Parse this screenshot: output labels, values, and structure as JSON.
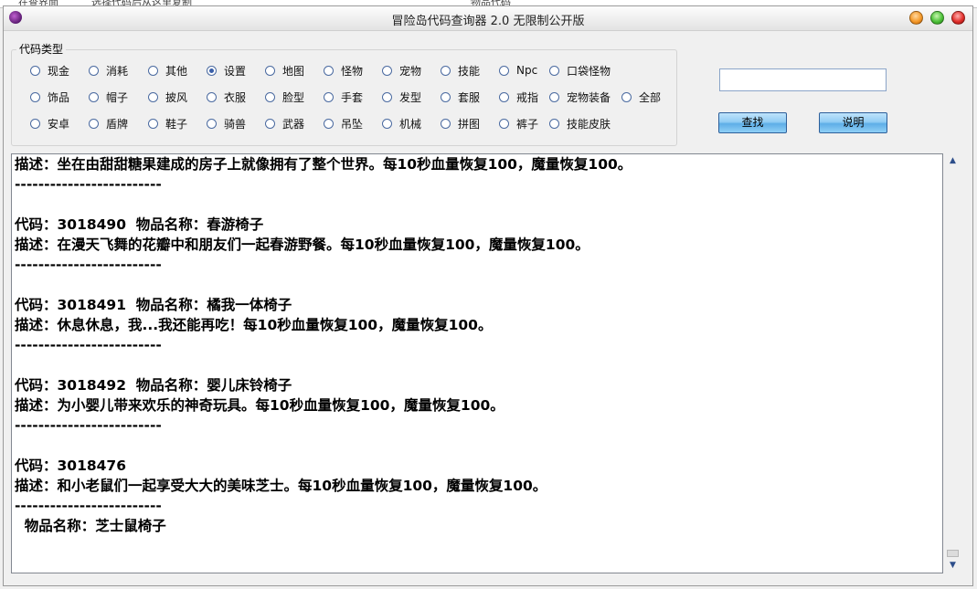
{
  "background_window": {
    "left_text": "在查界面",
    "mid_text": "选择代码后从这里复制",
    "right_text": "物品代码"
  },
  "window": {
    "title": "冒险岛代码查询器 2.0 无限制公开版",
    "controls": {
      "minimize": "minimize",
      "maximize": "maximize",
      "close": "close"
    }
  },
  "code_type": {
    "label": "代码类型",
    "selected": "设置",
    "options": [
      {
        "label": "现金",
        "checked": false
      },
      {
        "label": "消耗",
        "checked": false
      },
      {
        "label": "其他",
        "checked": false
      },
      {
        "label": "设置",
        "checked": true
      },
      {
        "label": "地图",
        "checked": false
      },
      {
        "label": "怪物",
        "checked": false
      },
      {
        "label": "宠物",
        "checked": false
      },
      {
        "label": "技能",
        "checked": false
      },
      {
        "label": "Npc",
        "checked": false
      },
      {
        "label": "口袋怪物",
        "checked": false
      },
      {
        "label": "饰品",
        "checked": false
      },
      {
        "label": "帽子",
        "checked": false
      },
      {
        "label": "披风",
        "checked": false
      },
      {
        "label": "衣服",
        "checked": false
      },
      {
        "label": "脸型",
        "checked": false
      },
      {
        "label": "手套",
        "checked": false
      },
      {
        "label": "发型",
        "checked": false
      },
      {
        "label": "套服",
        "checked": false
      },
      {
        "label": "戒指",
        "checked": false
      },
      {
        "label": "宠物装备",
        "checked": false
      },
      {
        "label": "全部",
        "checked": false
      },
      {
        "label": "安卓",
        "checked": false
      },
      {
        "label": "盾牌",
        "checked": false
      },
      {
        "label": "鞋子",
        "checked": false
      },
      {
        "label": "骑兽",
        "checked": false
      },
      {
        "label": "武器",
        "checked": false
      },
      {
        "label": "吊坠",
        "checked": false
      },
      {
        "label": "机械",
        "checked": false
      },
      {
        "label": "拼图",
        "checked": false
      },
      {
        "label": "裤子",
        "checked": false
      },
      {
        "label": "技能皮肤",
        "checked": false
      }
    ]
  },
  "search": {
    "value": "",
    "placeholder": ""
  },
  "buttons": {
    "find": "查找",
    "help": "说明"
  },
  "results": {
    "lines": [
      "描述：坐在由甜甜糖果建成的房子上就像拥有了整个世界。每10秒血量恢复100，魔量恢复100。",
      "-------------------------",
      "",
      "代码：3018490  物品名称：春游椅子",
      "描述：在漫天飞舞的花瓣中和朋友们一起春游野餐。每10秒血量恢复100，魔量恢复100。",
      "-------------------------",
      "",
      "代码：3018491  物品名称：橘我一体椅子",
      "描述：休息休息，我...我还能再吃！每10秒血量恢复100，魔量恢复100。",
      "-------------------------",
      "",
      "代码：3018492  物品名称：婴儿床铃椅子",
      "描述：为小婴儿带来欢乐的神奇玩具。每10秒血量恢复100，魔量恢复100。",
      "-------------------------",
      "",
      "代码：3018476",
      "描述：和小老鼠们一起享受大大的美味芝士。每10秒血量恢复100，魔量恢复100。",
      "-------------------------",
      "  物品名称：芝士鼠椅子"
    ]
  },
  "scrollbar": {
    "position": 0.98
  },
  "colors": {
    "accent": "#5eaee7",
    "radio_checked": "#3a5fa8",
    "close": "#e2302c",
    "minimize": "#f59a2a",
    "maximize": "#4ec23a"
  }
}
